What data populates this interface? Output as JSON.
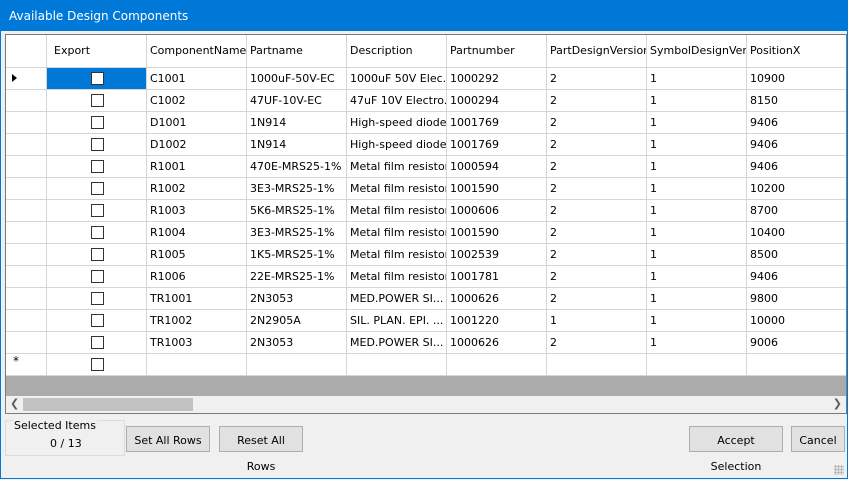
{
  "window": {
    "title": "Available Design Components"
  },
  "grid": {
    "columns": [
      "Export",
      "ComponentName",
      "Partname",
      "Description",
      "Partnumber",
      "PartDesignVersion",
      "SymbolDesignVersi",
      "PositionX"
    ],
    "rows": [
      {
        "component": "C1001",
        "partname": "1000uF-50V-EC",
        "description": "1000uF 50V Elec...",
        "partnumber": "1000292",
        "part_design_version": "2",
        "symbol_design_version": "1",
        "position_x": "10900"
      },
      {
        "component": "C1002",
        "partname": "47UF-10V-EC",
        "description": "47uF 10V Electro...",
        "partnumber": "1000294",
        "part_design_version": "2",
        "symbol_design_version": "1",
        "position_x": "8150"
      },
      {
        "component": "D1001",
        "partname": "1N914",
        "description": "High-speed diode",
        "partnumber": "1001769",
        "part_design_version": "2",
        "symbol_design_version": "1",
        "position_x": "9406"
      },
      {
        "component": "D1002",
        "partname": "1N914",
        "description": "High-speed diode",
        "partnumber": "1001769",
        "part_design_version": "2",
        "symbol_design_version": "1",
        "position_x": "9406"
      },
      {
        "component": "R1001",
        "partname": "470E-MRS25-1%",
        "description": "Metal film resistor ...",
        "partnumber": "1000594",
        "part_design_version": "2",
        "symbol_design_version": "1",
        "position_x": "9406"
      },
      {
        "component": "R1002",
        "partname": "3E3-MRS25-1%",
        "description": "Metal film resistor ...",
        "partnumber": "1001590",
        "part_design_version": "2",
        "symbol_design_version": "1",
        "position_x": "10200"
      },
      {
        "component": "R1003",
        "partname": "5K6-MRS25-1%",
        "description": "Metal film resistor ...",
        "partnumber": "1000606",
        "part_design_version": "2",
        "symbol_design_version": "1",
        "position_x": "8700"
      },
      {
        "component": "R1004",
        "partname": "3E3-MRS25-1%",
        "description": "Metal film resistor ...",
        "partnumber": "1001590",
        "part_design_version": "2",
        "symbol_design_version": "1",
        "position_x": "10400"
      },
      {
        "component": "R1005",
        "partname": "1K5-MRS25-1%",
        "description": "Metal film resistor ...",
        "partnumber": "1002539",
        "part_design_version": "2",
        "symbol_design_version": "1",
        "position_x": "8500"
      },
      {
        "component": "R1006",
        "partname": "22E-MRS25-1%",
        "description": "Metal film resistor ...",
        "partnumber": "1001781",
        "part_design_version": "2",
        "symbol_design_version": "1",
        "position_x": "9406"
      },
      {
        "component": "TR1001",
        "partname": "2N3053",
        "description": "MED.POWER SI...",
        "partnumber": "1000626",
        "part_design_version": "2",
        "symbol_design_version": "1",
        "position_x": "9800"
      },
      {
        "component": "TR1002",
        "partname": "2N2905A",
        "description": "SIL. PLAN. EPI. ...",
        "partnumber": "1001220",
        "part_design_version": "1",
        "symbol_design_version": "1",
        "position_x": "10000"
      },
      {
        "component": "TR1003",
        "partname": "2N3053",
        "description": "MED.POWER SI...",
        "partnumber": "1000626",
        "part_design_version": "2",
        "symbol_design_version": "1",
        "position_x": "9006"
      }
    ],
    "new_row_marker": "*"
  },
  "footer": {
    "selected_items_label": "Selected Items",
    "selected_count": "0 / 13",
    "set_all_rows": "Set All Rows",
    "reset_all_rows": "Reset All Rows",
    "accept_selection": "Accept Selection",
    "cancel": "Cancel"
  },
  "colors": {
    "accent": "#0078d7",
    "grid_background": "#ababab"
  },
  "icons": [
    "current-row-arrow-icon",
    "new-row-star-icon",
    "scroll-left-arrow-icon",
    "scroll-right-arrow-icon",
    "resize-grip-icon"
  ]
}
